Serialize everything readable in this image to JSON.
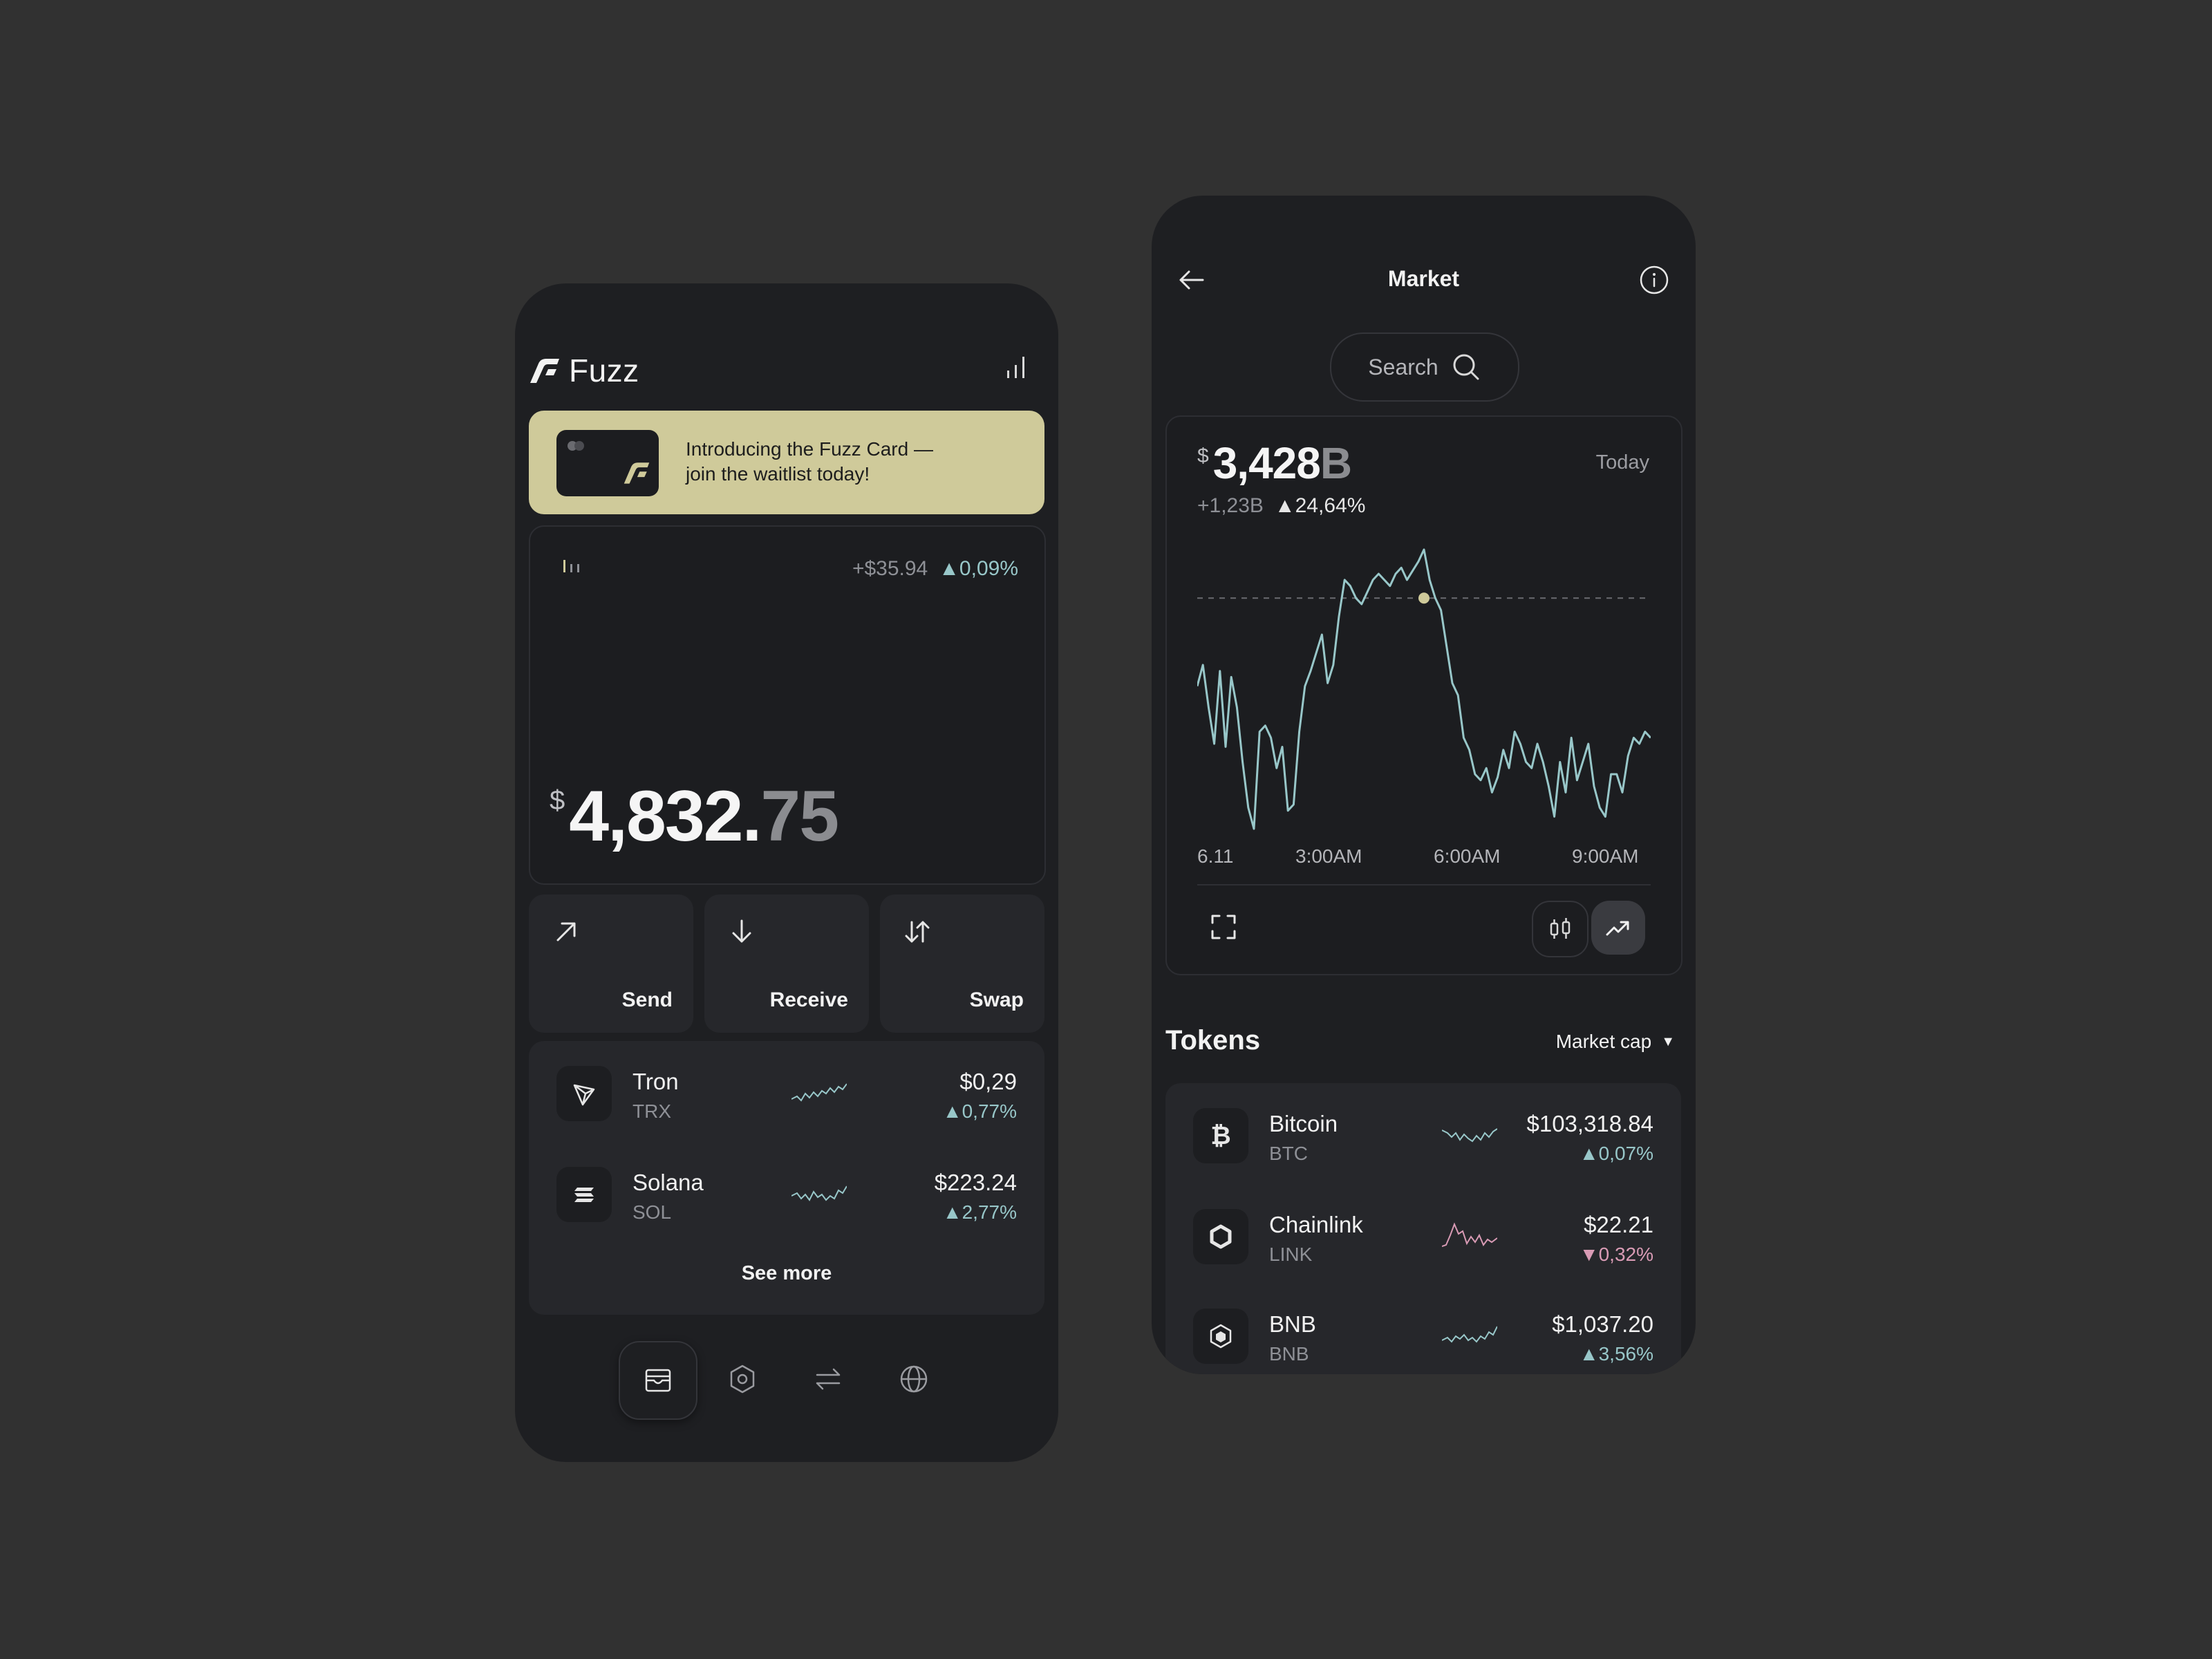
{
  "wallet": {
    "brand": "Fuzz",
    "promo": {
      "line1": "Introducing the Fuzz Card —",
      "line2": "join the waitlist today!"
    },
    "balance": {
      "currency": "$",
      "integer": "4,832.",
      "decimals": "75",
      "delta": "+$35.94",
      "delta_pct": "▲0,09%"
    },
    "actions": [
      {
        "label": "Send",
        "icon": "arrow-up-right-icon"
      },
      {
        "label": "Receive",
        "icon": "arrow-down-icon"
      },
      {
        "label": "Swap",
        "icon": "swap-vertical-icon"
      }
    ],
    "tokens": [
      {
        "name": "Tron",
        "symbol": "TRX",
        "price": "$0,29",
        "change": "▲0,77%",
        "trend": "up",
        "icon": "tron-icon"
      },
      {
        "name": "Solana",
        "symbol": "SOL",
        "price": "$223.24",
        "change": "▲2,77%",
        "trend": "up",
        "icon": "solana-icon"
      }
    ],
    "see_more": "See more",
    "nav": [
      {
        "name": "wallet-icon",
        "active": true
      },
      {
        "name": "hexagon-icon",
        "active": false
      },
      {
        "name": "swap-icon",
        "active": false
      },
      {
        "name": "globe-icon",
        "active": false
      }
    ]
  },
  "market": {
    "title": "Market",
    "search_label": "Search",
    "value": {
      "currency": "$",
      "number": "3,428",
      "suffix": "B"
    },
    "period": "Today",
    "change_abs": "+1,23B",
    "change_pct": "▲24,64%",
    "tokens_heading": "Tokens",
    "sort_label": "Market cap",
    "sort_caret": "▼",
    "tokens": [
      {
        "name": "Bitcoin",
        "symbol": "BTC",
        "price": "$103,318.84",
        "change": "▲0,07%",
        "trend": "up",
        "icon": "bitcoin-icon"
      },
      {
        "name": "Chainlink",
        "symbol": "LINK",
        "price": "$22.21",
        "change": "▼0,32%",
        "trend": "down",
        "icon": "chainlink-icon"
      },
      {
        "name": "BNB",
        "symbol": "BNB",
        "price": "$1,037.20",
        "change": "▲3,56%",
        "trend": "up",
        "icon": "bnb-icon"
      }
    ]
  },
  "colors": {
    "accent": "#cfca9a",
    "up": "#98c7c9",
    "down": "#d99bb5",
    "panel": "#1e1f22",
    "background": "#313131"
  },
  "chart_data": {
    "type": "line",
    "x_ticks": [
      "6.11",
      "3:00AM",
      "6:00AM",
      "9:00AM"
    ],
    "x": [
      0,
      1,
      2,
      3,
      4,
      5,
      6,
      7,
      8,
      9,
      10,
      11,
      12,
      13,
      14,
      15,
      16,
      17,
      18,
      19,
      20,
      21,
      22,
      23,
      24,
      25,
      26,
      27,
      28,
      29,
      30,
      31,
      32,
      33,
      34,
      35,
      36,
      37,
      38,
      39,
      40,
      41,
      42,
      43,
      44,
      45,
      46,
      47,
      48,
      49,
      50,
      51,
      52,
      53,
      54,
      55,
      56,
      57,
      58,
      59,
      60,
      61,
      62,
      63,
      64,
      65,
      66,
      67,
      68,
      69,
      70,
      71,
      72,
      73,
      74,
      75,
      76,
      77,
      78,
      79,
      80
    ],
    "y": [
      55,
      62,
      48,
      36,
      60,
      35,
      58,
      48,
      30,
      15,
      8,
      40,
      42,
      38,
      28,
      35,
      14,
      16,
      40,
      55,
      60,
      66,
      72,
      56,
      62,
      78,
      90,
      88,
      84,
      82,
      86,
      90,
      92,
      90,
      88,
      92,
      94,
      90,
      93,
      96,
      100,
      90,
      84,
      80,
      68,
      56,
      52,
      38,
      34,
      26,
      24,
      28,
      20,
      25,
      34,
      28,
      40,
      36,
      30,
      28,
      36,
      30,
      22,
      12,
      30,
      20,
      38,
      24,
      30,
      36,
      22,
      15,
      12,
      26,
      26,
      20,
      32,
      38,
      36,
      40,
      38
    ],
    "reference_value": 84,
    "highlight_index": 40,
    "grid": false
  }
}
